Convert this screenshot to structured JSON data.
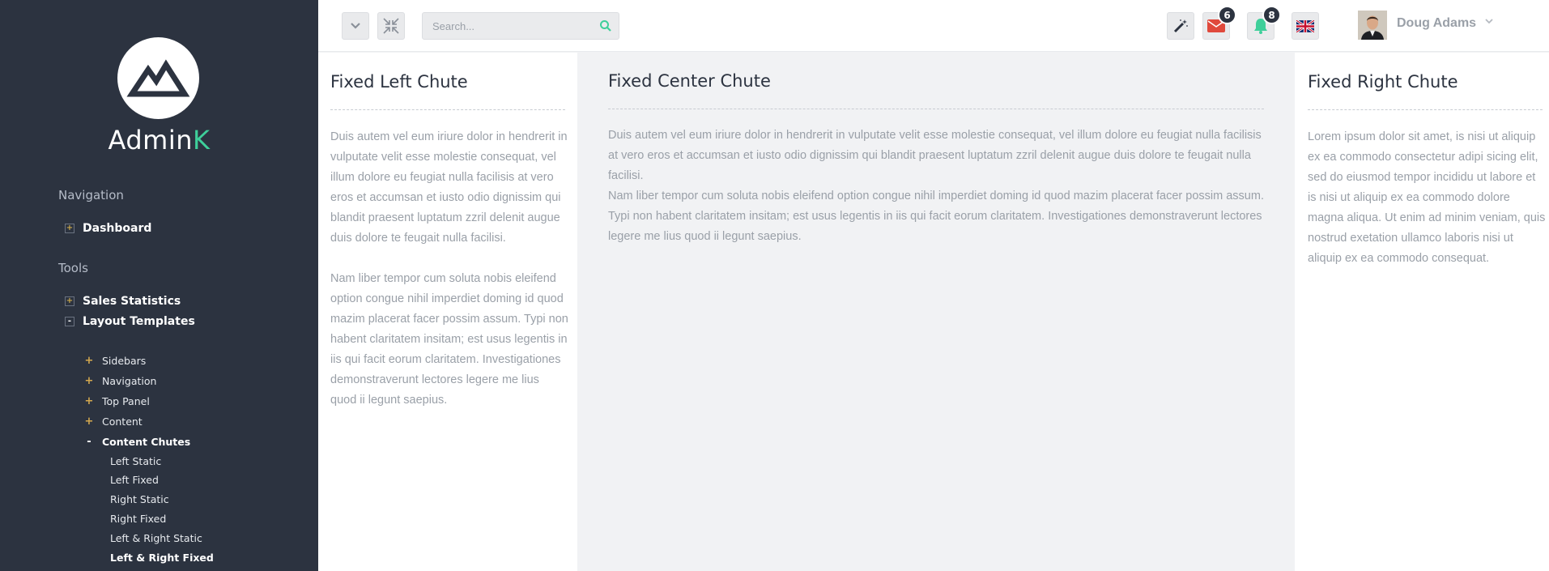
{
  "brand": {
    "name_main": "Admin",
    "name_accent": "K"
  },
  "sidebar": {
    "section_navigation": "Navigation",
    "section_tools": "Tools",
    "items": [
      {
        "label": "Dashboard",
        "toggle": "+"
      },
      {
        "label": "Sales Statistics",
        "toggle": "+"
      },
      {
        "label": "Layout Templates",
        "toggle": "-"
      }
    ],
    "sub_items": [
      {
        "label": "Sidebars",
        "toggle": "+"
      },
      {
        "label": "Navigation",
        "toggle": "+"
      },
      {
        "label": "Top Panel",
        "toggle": "+"
      },
      {
        "label": "Content",
        "toggle": "+"
      },
      {
        "label": "Content Chutes",
        "toggle": "-"
      }
    ],
    "chute_items": [
      {
        "label": "Left Static"
      },
      {
        "label": "Left Fixed"
      },
      {
        "label": "Right Static"
      },
      {
        "label": "Right Fixed"
      },
      {
        "label": "Left & Right Static"
      },
      {
        "label": "Left & Right Fixed"
      }
    ]
  },
  "topbar": {
    "search_placeholder": "Search...",
    "messages_count": "6",
    "notifications_count": "8",
    "user_name": "Doug Adams"
  },
  "colors": {
    "sidebar_bg": "#2c3340",
    "accent": "#3ecf9a",
    "mail": "#e0493c",
    "bell": "#3ecf9a"
  },
  "content": {
    "left": {
      "title": "Fixed Left Chute",
      "p1": "Duis autem vel eum iriure dolor in hendrerit in vulputate velit esse molestie consequat, vel illum dolore eu feugiat nulla facilisis at vero eros et accumsan et iusto odio dignissim qui blandit praesent luptatum zzril delenit augue duis dolore te feugait nulla facilisi.",
      "p2": "Nam liber tempor cum soluta nobis eleifend option congue nihil imperdiet doming id quod mazim placerat facer possim assum. Typi non habent claritatem insitam; est usus legentis in iis qui facit eorum claritatem. Investigationes demonstraverunt lectores legere me lius quod ii legunt saepius."
    },
    "center": {
      "title": "Fixed Center Chute",
      "p1": "Duis autem vel eum iriure dolor in hendrerit in vulputate velit esse molestie consequat, vel illum dolore eu feugiat nulla facilisis at vero eros et accumsan et iusto odio dignissim qui blandit praesent luptatum zzril delenit augue duis dolore te feugait nulla facilisi.",
      "p2": "Nam liber tempor cum soluta nobis eleifend option congue nihil imperdiet doming id quod mazim placerat facer possim assum. Typi non habent claritatem insitam; est usus legentis in iis qui facit eorum claritatem. Investigationes demonstraverunt lectores legere me lius quod ii legunt saepius."
    },
    "right": {
      "title": "Fixed Right Chute",
      "p1": "Lorem ipsum dolor sit amet, is nisi ut aliquip ex ea commodo consectetur adipi sicing elit, sed do eiusmod tempor incididu ut labore et is nisi ut aliquip ex ea commodo dolore magna aliqua. Ut enim ad minim veniam, quis nostrud exetation ullamco laboris nisi ut aliquip ex ea commodo consequat."
    }
  }
}
